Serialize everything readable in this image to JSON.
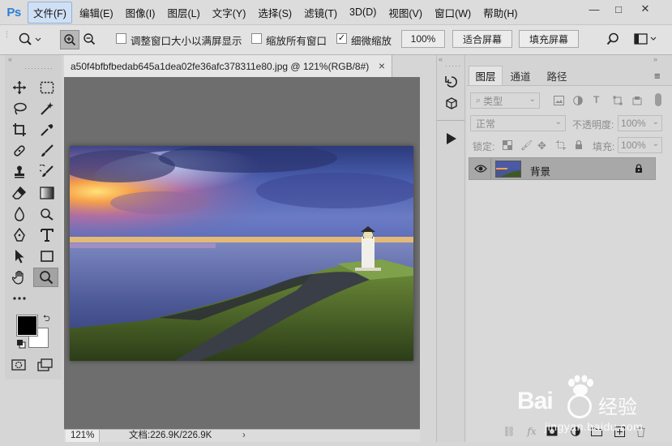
{
  "app": {
    "logo": "Ps"
  },
  "menu": [
    {
      "label": "文件(F)",
      "active": true
    },
    {
      "label": "编辑(E)"
    },
    {
      "label": "图像(I)"
    },
    {
      "label": "图层(L)"
    },
    {
      "label": "文字(Y)"
    },
    {
      "label": "选择(S)"
    },
    {
      "label": "滤镜(T)"
    },
    {
      "label": "3D(D)"
    },
    {
      "label": "视图(V)"
    },
    {
      "label": "窗口(W)"
    },
    {
      "label": "帮助(H)"
    }
  ],
  "window_controls": {
    "minimize": "—",
    "maximize": "□",
    "close": "✕"
  },
  "options": {
    "resize_windows_label": "调整窗口大小以满屏显示",
    "resize_windows_checked": false,
    "zoom_all_windows_label": "缩放所有窗口",
    "zoom_all_windows_checked": false,
    "scrubby_zoom_label": "细微缩放",
    "scrubby_zoom_checked": true,
    "zoom_percent": "100%",
    "fit_screen": "适合屏幕",
    "fill_screen": "填充屏幕"
  },
  "document": {
    "tab_title": "a50f4bfbfbedab645a1dea02fe36afc378311e80.jpg @ 121%(RGB/8#)",
    "close": "×",
    "zoom": "121%",
    "doc_size": "文档:226.9K/226.9K",
    "status_arrow": "›"
  },
  "layers_panel": {
    "tabs": [
      "图层",
      "通道",
      "路径"
    ],
    "active_tab": 0,
    "filter_kind": "类型",
    "blend_mode": "正常",
    "opacity_label": "不透明度:",
    "opacity_value": "100%",
    "lock_label": "锁定:",
    "fill_label": "填充:",
    "fill_value": "100%",
    "layers": [
      {
        "name": "背景",
        "visible": true,
        "locked": true
      }
    ]
  },
  "watermark": {
    "brand": "Bai",
    "brand_suffix": "经验",
    "url": "jingyan.baidu.com"
  },
  "colors": {
    "foreground": "#000000",
    "background": "#ffffff",
    "canvas_bg": "#6e6e6e",
    "ps_logo": "#2a7fd9"
  }
}
